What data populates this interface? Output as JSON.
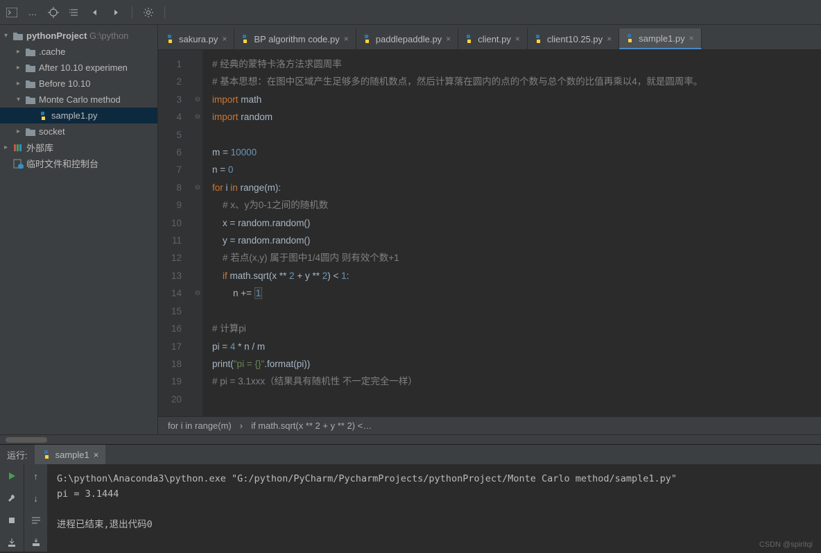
{
  "toolbar": {
    "icons": [
      "terminal",
      "target",
      "select-all",
      "back",
      "forward",
      "divider",
      "gear",
      "divider2"
    ]
  },
  "tree": {
    "root": {
      "name": "pythonProject",
      "path": "G:\\python"
    },
    "items": [
      {
        "indent": 1,
        "arrow": "▸",
        "icon": "folder",
        "label": ".cache"
      },
      {
        "indent": 1,
        "arrow": "▸",
        "icon": "folder",
        "label": "After 10.10 experimen"
      },
      {
        "indent": 1,
        "arrow": "▸",
        "icon": "folder",
        "label": "Before 10.10"
      },
      {
        "indent": 1,
        "arrow": "▾",
        "icon": "folder",
        "label": "Monte Carlo method"
      },
      {
        "indent": 2,
        "arrow": "",
        "icon": "py",
        "label": "sample1.py",
        "selected": true
      },
      {
        "indent": 1,
        "arrow": "▸",
        "icon": "folder",
        "label": "socket"
      }
    ],
    "lib": {
      "arrow": "▸",
      "label": "外部库"
    },
    "scratch": {
      "label": "临时文件和控制台"
    }
  },
  "tabs": [
    {
      "icon": "py",
      "label": "sakura.py"
    },
    {
      "icon": "py",
      "label": "BP algorithm code.py"
    },
    {
      "icon": "py",
      "label": "paddlepaddle.py"
    },
    {
      "icon": "py",
      "label": "client.py"
    },
    {
      "icon": "py",
      "label": "client10.25.py"
    },
    {
      "icon": "py",
      "label": "sample1.py",
      "active": true
    }
  ],
  "code": {
    "lines": [
      {
        "n": 1,
        "fold": "",
        "html": "<span class='c-cmt'># 经典的蒙特卡洛方法求圆周率</span>"
      },
      {
        "n": 2,
        "fold": "",
        "html": "<span class='c-cmt'># 基本思想：在图中区域产生足够多的随机数点，然后计算落在圆内的点的个数与总个数的比值再乘以4，就是圆周率。</span>"
      },
      {
        "n": 3,
        "fold": "⊖",
        "html": "<span class='c-kw'>import</span> math"
      },
      {
        "n": 4,
        "fold": "⊖",
        "html": "<span class='c-kw'>import</span> random"
      },
      {
        "n": 5,
        "fold": "",
        "html": ""
      },
      {
        "n": 6,
        "fold": "",
        "html": "m = <span class='c-num'>10000</span>"
      },
      {
        "n": 7,
        "fold": "",
        "html": "n = <span class='c-num'>0</span>"
      },
      {
        "n": 8,
        "fold": "⊖",
        "html": "<span class='c-kw'>for</span> i <span class='c-kw'>in</span> range(m):"
      },
      {
        "n": 9,
        "fold": "",
        "html": "    <span class='c-cmt'># x、y为0-1之间的随机数</span>"
      },
      {
        "n": 10,
        "fold": "",
        "html": "    x = random.random()"
      },
      {
        "n": 11,
        "fold": "",
        "html": "    y = random.random()"
      },
      {
        "n": 12,
        "fold": "",
        "html": "    <span class='c-cmt'># 若点(x,y) 属于图中1/4圆内 则有效个数+1</span>"
      },
      {
        "n": 13,
        "fold": "",
        "html": "    <span class='c-kw'>if</span> math.sqrt(x ** <span class='c-num'>2</span> + y ** <span class='c-num'>2</span>) &lt; <span class='c-num'>1</span>:"
      },
      {
        "n": 14,
        "fold": "⊖",
        "html": "        n += <span class='c-num c-highlight'>1</span>"
      },
      {
        "n": 15,
        "fold": "",
        "html": ""
      },
      {
        "n": 16,
        "fold": "",
        "html": "<span class='c-cmt'># 计算pi</span>"
      },
      {
        "n": 17,
        "fold": "",
        "html": "pi = <span class='c-num'>4</span> * n / m"
      },
      {
        "n": 18,
        "fold": "",
        "html": "print(<span class='c-str'>\"pi = {}\"</span>.format(pi))"
      },
      {
        "n": 19,
        "fold": "",
        "html": "<span class='c-cmt'># pi = 3.1xxx（结果具有随机性 不一定完全一样）</span>"
      },
      {
        "n": 20,
        "fold": "",
        "html": ""
      }
    ]
  },
  "breadcrumb": [
    "for i in range(m)",
    "if math.sqrt(x ** 2 + y ** 2) <…"
  ],
  "run": {
    "label": "运行:",
    "tab": "sample1",
    "console": "G:\\python\\Anaconda3\\python.exe \"G:/python/PyCharm/PycharmProjects/pythonProject/Monte Carlo method/sample1.py\"\npi = 3.1444\n\n进程已结束,退出代码0"
  },
  "watermark": "CSDN @spiritqi"
}
